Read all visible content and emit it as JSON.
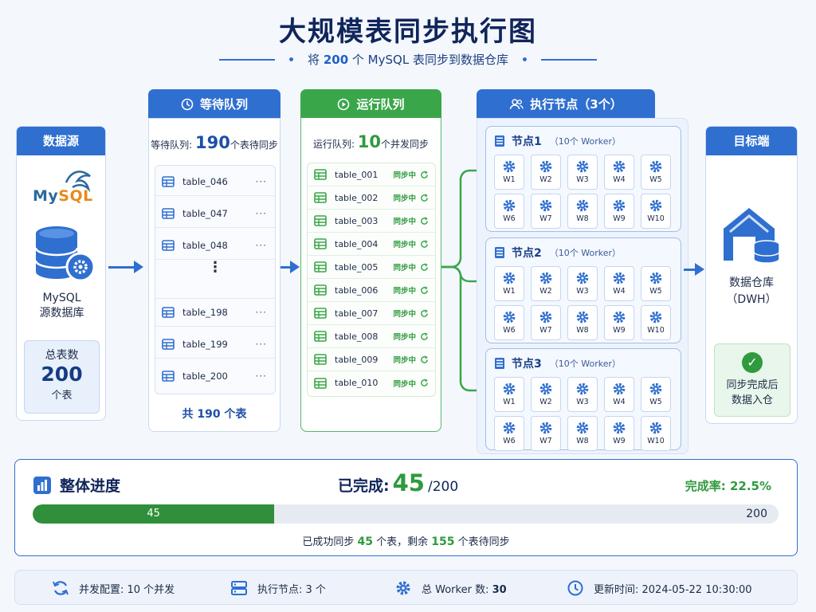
{
  "title": "大规模表同步执行图",
  "subtitle": {
    "pre": "将 ",
    "num": "200",
    "post": " 个 MySQL 表同步到数据仓库"
  },
  "source": {
    "header": "数据源",
    "logo_my": "My",
    "logo_sql": "SQL",
    "name_line1": "MySQL",
    "name_line2": "源数据库",
    "total_label": "总表数",
    "total_value": "200",
    "total_unit": "个表"
  },
  "waiting": {
    "header": "等待队列",
    "caption_pre": "等待队列: ",
    "caption_num": "190",
    "caption_post": "个表待同步",
    "items": [
      "table_046",
      "table_047",
      "table_048",
      "table_198",
      "table_199",
      "table_200"
    ],
    "ellipsis": "⋮",
    "more": "···",
    "total": "共 190 个表"
  },
  "running": {
    "header": "运行队列",
    "caption_pre": "运行队列: ",
    "caption_num": "10",
    "caption_post": "个并发同步",
    "status": "同步中",
    "items": [
      "table_001",
      "table_002",
      "table_003",
      "table_004",
      "table_005",
      "table_006",
      "table_007",
      "table_008",
      "table_009",
      "table_010"
    ]
  },
  "nodes": {
    "header": "执行节点（3个）",
    "list": [
      {
        "name": "节点1",
        "workers_label": "（10个 Worker）"
      },
      {
        "name": "节点2",
        "workers_label": "（10个 Worker）"
      },
      {
        "name": "节点3",
        "workers_label": "（10个 Worker）"
      }
    ],
    "worker_labels": [
      "W1",
      "W2",
      "W3",
      "W4",
      "W5",
      "W6",
      "W7",
      "W8",
      "W9",
      "W10"
    ]
  },
  "target": {
    "header": "目标端",
    "name_line1": "数据仓库",
    "name_line2": "（DWH）",
    "done_line1": "同步完成后",
    "done_line2": "数据入仓"
  },
  "progress": {
    "title": "整体进度",
    "done_label": "已完成:",
    "done_value": "45",
    "done_total": "/200",
    "rate": "完成率:  22.5%",
    "fraction": 0.225,
    "bar_value": "45",
    "bar_max": "200",
    "note_pre": "已成功同步 ",
    "note_done": "45",
    "note_mid": " 个表，剩余 ",
    "note_left": "155",
    "note_post": " 个表待同步"
  },
  "footer": {
    "concurrency": "并发配置: 10 个并发",
    "nodes": "执行节点: 3 个",
    "workers_label": "总 Worker 数: ",
    "workers_value": "30",
    "updated": "更新时间: 2024-05-22 10:30:00"
  },
  "colors": {
    "primary": "#2f6fd0",
    "success": "#3aa64a",
    "navy": "#10255a"
  }
}
